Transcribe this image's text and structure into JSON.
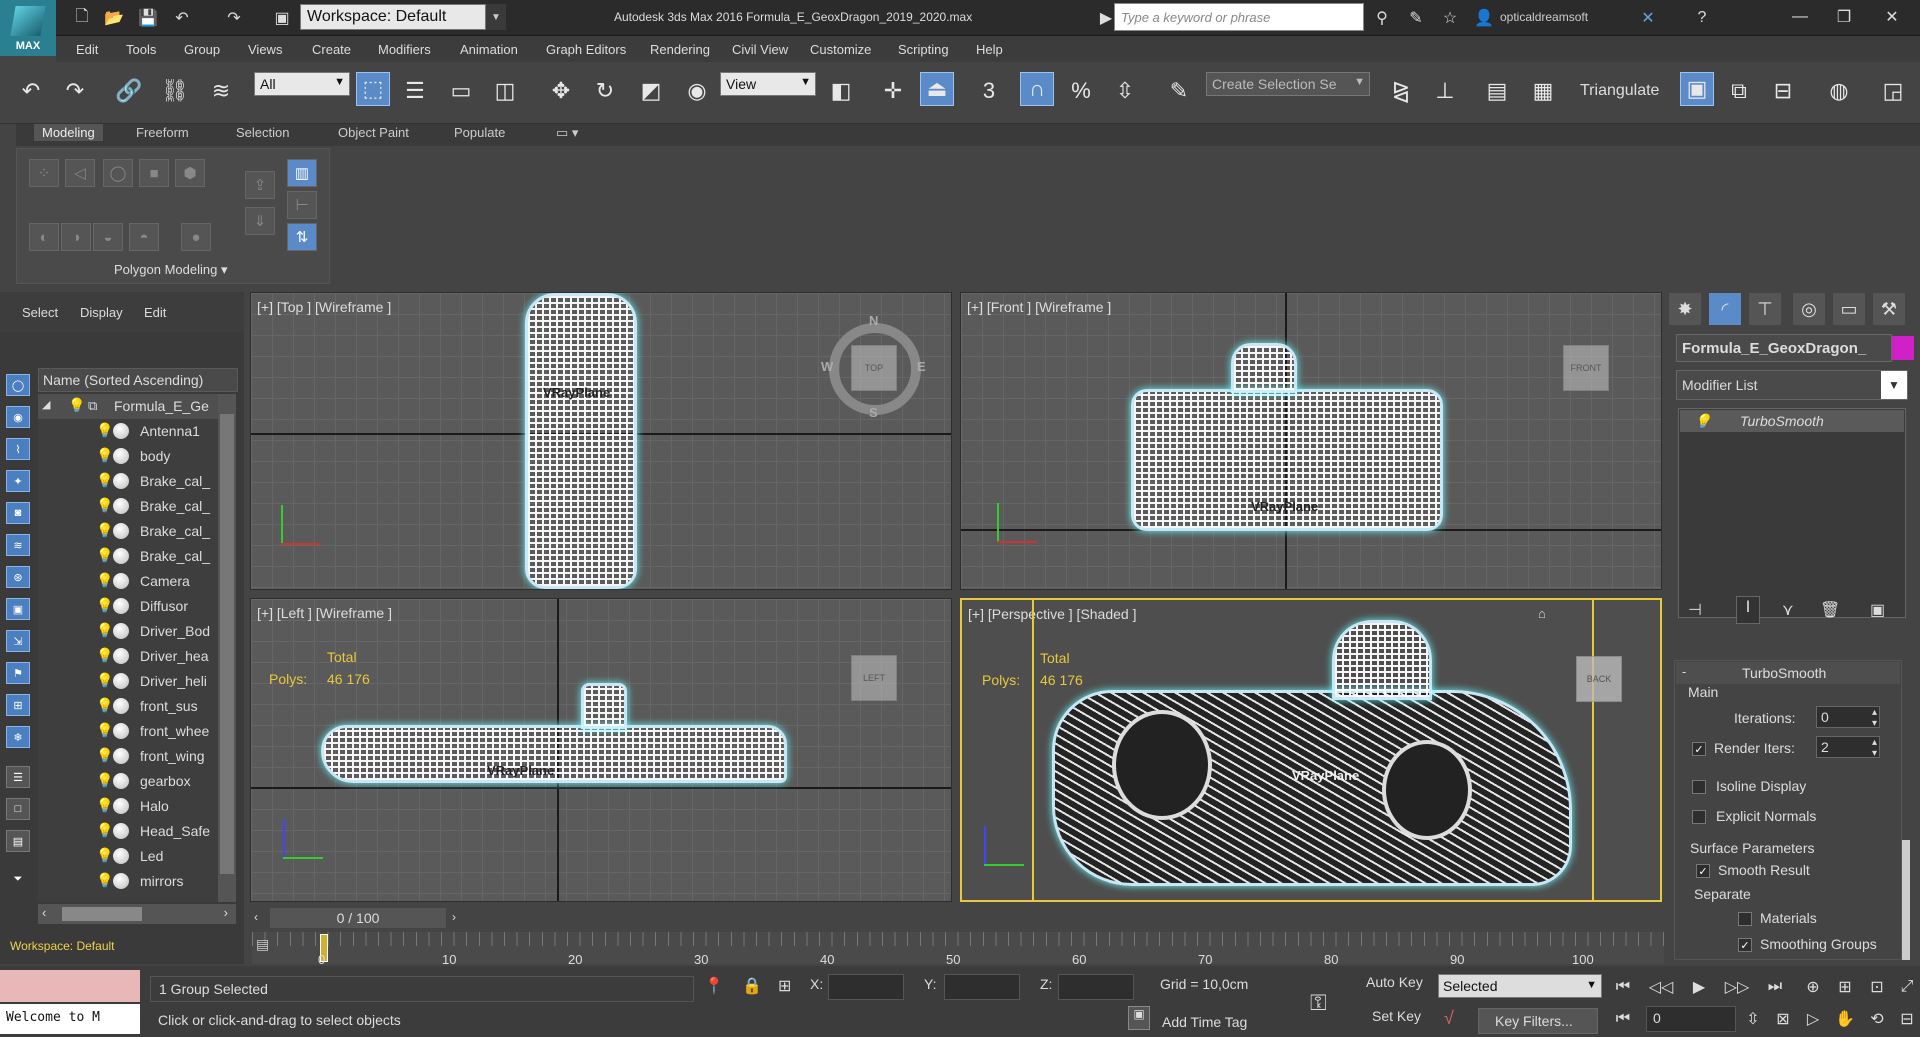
{
  "title_bar": {
    "logo_text": "MAX",
    "workspace": "Workspace: Default",
    "app_title": "Autodesk 3ds Max 2016    Formula_E_GeoxDragon_2019_2020.max",
    "search_placeholder": "Type a keyword or phrase",
    "user": "opticaldreamsoft"
  },
  "menu": [
    "Edit",
    "Tools",
    "Group",
    "Views",
    "Create",
    "Modifiers",
    "Animation",
    "Graph Editors",
    "Rendering",
    "Civil View",
    "Customize",
    "Scripting",
    "Help"
  ],
  "toolbar": {
    "filter": "All",
    "ref_coord": "View",
    "selection_set_placeholder": "Create Selection Se",
    "triangulate": "Triangulate",
    "snap_label": "3"
  },
  "ribbon": {
    "tabs": [
      "Modeling",
      "Freeform",
      "Selection",
      "Object Paint",
      "Populate"
    ],
    "panel_label": "Polygon Modeling"
  },
  "scene_explorer": {
    "tabs": [
      "Select",
      "Display",
      "Edit"
    ],
    "column_header": "Name (Sorted Ascending)",
    "root": "Formula_E_Ge",
    "items": [
      "Antenna1",
      "body",
      "Brake_cal_",
      "Brake_cal_",
      "Brake_cal_",
      "Brake_cal_",
      "Camera",
      "Diffusor",
      "Driver_Bod",
      "Driver_hea",
      "Driver_heli",
      "front_sus",
      "front_whee",
      "front_wing",
      "gearbox",
      "Halo",
      "Head_Safe",
      "Led",
      "mirrors"
    ],
    "workspace": "Workspace: Default"
  },
  "viewports": {
    "top": {
      "label": "[+] [Top ] [Wireframe ]",
      "compass": {
        "n": "N",
        "s": "S",
        "e": "E",
        "w": "W",
        "cube": "TOP"
      },
      "obj_label": "VRayPlane"
    },
    "front": {
      "label": "[+] [Front ] [Wireframe ]",
      "cube": "FRONT",
      "obj_label": "VRayPlane"
    },
    "left": {
      "label": "[+] [Left ] [Wireframe ]",
      "cube": "LEFT",
      "stats_total": "Total",
      "stats_polys_label": "Polys:",
      "stats_polys": "46 176",
      "obj_label": "VRayPlane"
    },
    "perspective": {
      "label": "[+] [Perspective ] [Shaded ]",
      "cube": "BACK",
      "stats_total": "Total",
      "stats_polys_label": "Polys:",
      "stats_polys": "46 176",
      "obj_label": "VRayPlane"
    }
  },
  "command_panel": {
    "object_name": "Formula_E_GeoxDragon_",
    "object_color": "#d020c8",
    "modifier_list": "Modifier List",
    "stack_item": "TurboSmooth",
    "rollout_title": "TurboSmooth",
    "main_group": "Main",
    "iterations_label": "Iterations:",
    "iterations": "0",
    "render_iters_label": "Render Iters:",
    "render_iters": "2",
    "isoline_display": "Isoline Display",
    "explicit_normals": "Explicit Normals",
    "surface_params": "Surface Parameters",
    "smooth_result": "Smooth Result",
    "separate": "Separate",
    "materials": "Materials",
    "smoothing_groups": "Smoothing Groups"
  },
  "timeline": {
    "slider": "0 / 100",
    "ticks": [
      "0",
      "10",
      "20",
      "30",
      "40",
      "50",
      "60",
      "70",
      "80",
      "90",
      "100"
    ]
  },
  "status": {
    "welcome": "Welcome to M",
    "selection": "1 Group Selected",
    "prompt": "Click or click-and-drag to select objects",
    "x_label": "X:",
    "y_label": "Y:",
    "z_label": "Z:",
    "grid": "Grid = 10,0cm",
    "add_time_tag": "Add Time Tag",
    "auto_key": "Auto Key",
    "set_key": "Set Key",
    "key_mode": "Selected",
    "key_filters": "Key Filters...",
    "frame": "0"
  }
}
